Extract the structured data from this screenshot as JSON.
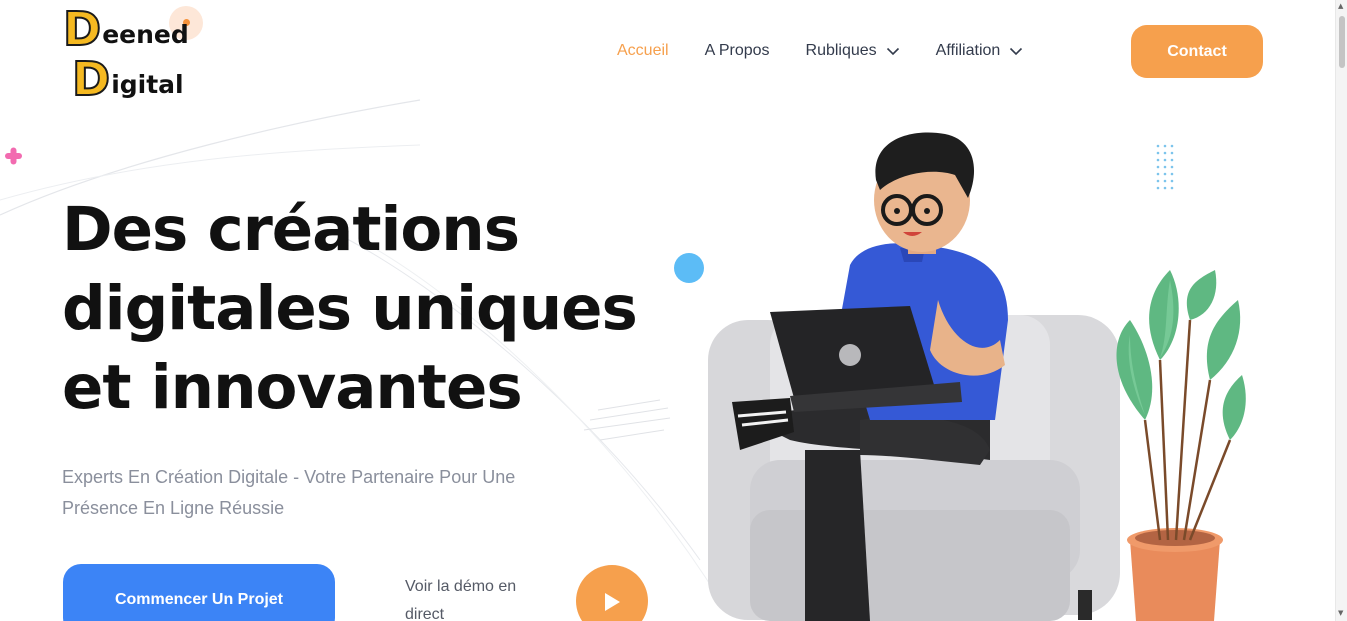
{
  "logo": {
    "line1_initial": "D",
    "line1_rest": "eened",
    "line2_initial": "D",
    "line2_rest": "igital"
  },
  "nav": {
    "items": [
      {
        "label": "Accueil",
        "active": true,
        "has_dropdown": false
      },
      {
        "label": "A Propos",
        "active": false,
        "has_dropdown": false
      },
      {
        "label": "Rubliques",
        "active": false,
        "has_dropdown": true
      },
      {
        "label": "Affiliation",
        "active": false,
        "has_dropdown": true
      }
    ],
    "contact_label": "Contact"
  },
  "hero": {
    "headline": [
      "Des créations",
      "digitales uniques",
      "et innovantes"
    ],
    "subtitle": "Experts En Création Digitale - Votre Partenaire Pour Une Présence En Ligne Réussie",
    "cta_label": "Commencer Un Projet",
    "demo_label": "Voir la démo en direct"
  },
  "colors": {
    "accent_orange": "#f6a04d",
    "cta_blue": "#3c84f6",
    "logo_yellow": "#f5b921",
    "headline": "#111111",
    "subtitle": "#8a8f9c",
    "nav_text": "#333b4c"
  },
  "icons": {
    "nav_dropdown": "chevron-down-icon",
    "play": "play-icon",
    "plus_decoration": "plus-icon"
  }
}
